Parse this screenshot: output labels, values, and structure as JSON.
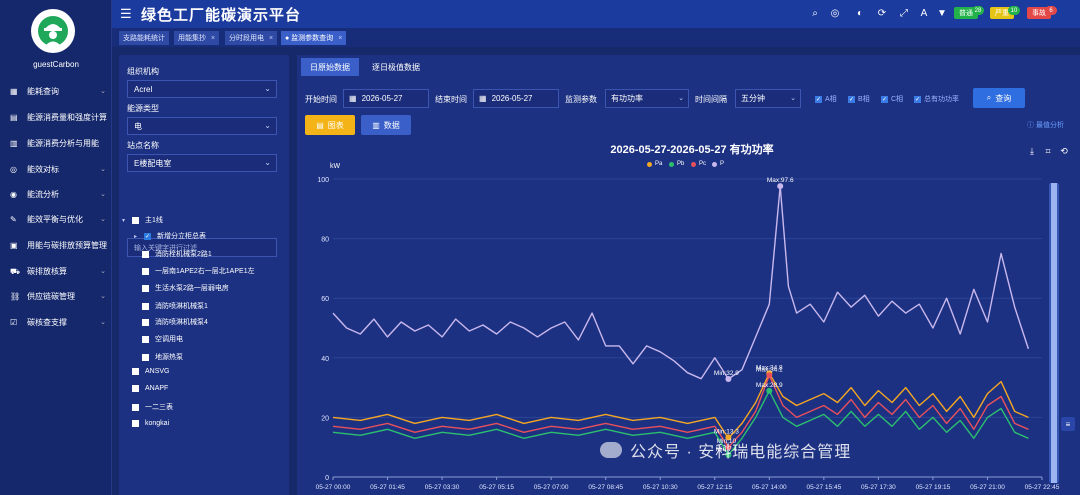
{
  "sidebar": {
    "user": "guestCarbon",
    "items": [
      {
        "label": "能耗查询",
        "icon": "dashboard-icon"
      },
      {
        "label": "能源消费量和强度计算",
        "icon": "ledger-icon"
      },
      {
        "label": "能源消费分析与用能",
        "icon": "analysis-icon"
      },
      {
        "label": "能效对标",
        "icon": "target-icon"
      },
      {
        "label": "能流分析",
        "icon": "globe-icon"
      },
      {
        "label": "能效平衡与优化",
        "icon": "edit-icon"
      },
      {
        "label": "用能与碳排放预算管理",
        "icon": "building-icon"
      },
      {
        "label": "碳排放核算",
        "icon": "truck-icon"
      },
      {
        "label": "供应链碳管理",
        "icon": "link-icon"
      },
      {
        "label": "碳核查支撑",
        "icon": "check-icon"
      }
    ]
  },
  "header": {
    "title": "绿色工厂能碳演示平台",
    "badges": [
      {
        "label": "普通",
        "count": "28",
        "color": "#23b24a"
      },
      {
        "label": "严重",
        "count": "10",
        "color": "#e6c415"
      },
      {
        "label": "事故",
        "count": "6",
        "color": "#e34848"
      }
    ]
  },
  "tabs": [
    {
      "label": "支路能耗统计",
      "close": ""
    },
    {
      "label": "用能集抄",
      "close": "×"
    },
    {
      "label": "分时段用电",
      "close": "×"
    },
    {
      "label": "● 监测参数查询",
      "close": "×"
    }
  ],
  "filter": {
    "org_label": "组织机构",
    "org_value": "Acrel",
    "energy_label": "能源类型",
    "energy_value": "电",
    "site_label": "站点名称",
    "site_value": "E楼配电室",
    "search_placeholder": "输入关键字进行过滤",
    "tree": [
      {
        "label": "主1线",
        "checked": false,
        "arrow": "▾"
      },
      {
        "label": "新增分立柜总表",
        "checked": true,
        "arrow": "▸"
      },
      {
        "label": "消防栓机械泵2路1",
        "checked": false,
        "arrow": ""
      },
      {
        "label": "一层南1APE2右一层北1APE1左",
        "checked": false,
        "arrow": ""
      },
      {
        "label": "生活水泵2路一层弱电房",
        "checked": false,
        "arrow": ""
      },
      {
        "label": "消防喷淋机械泵1",
        "checked": false,
        "arrow": ""
      },
      {
        "label": "消防喷淋机械泵4",
        "checked": false,
        "arrow": ""
      },
      {
        "label": "空调用电",
        "checked": false,
        "arrow": ""
      },
      {
        "label": "地源热泵",
        "checked": false,
        "arrow": ""
      },
      {
        "label": "ANSVG",
        "checked": false,
        "arrow": ""
      },
      {
        "label": "ANAPF",
        "checked": false,
        "arrow": ""
      },
      {
        "label": "一二三表",
        "checked": false,
        "arrow": ""
      },
      {
        "label": "kongkai",
        "checked": false,
        "arrow": ""
      }
    ]
  },
  "main": {
    "tabs": [
      "日原始数据",
      "逐日极值数据"
    ],
    "start_label": "开始时间",
    "start_value": "2026-05-27",
    "end_label": "结束时间",
    "end_value": "2026-05-27",
    "param_label": "监测参数",
    "param_value": "有功功率",
    "interval_label": "时间间隔",
    "interval_value": "五分钟",
    "checks": [
      "A相",
      "B相",
      "C相",
      "总有功功率"
    ],
    "query_label": "查询",
    "chart_btn": "图表",
    "data_btn": "数据",
    "extreme_label": "最值分析",
    "watermark": "公众号 · 安科瑞电能综合管理"
  },
  "chart_data": {
    "type": "line",
    "title": "2026-05-27-2026-05-27  有功功率",
    "unit": "kW",
    "ylim": [
      0,
      100
    ],
    "y_ticks": [
      "0",
      "20",
      "40",
      "60",
      "80",
      "100"
    ],
    "x_ticks": [
      "05-27 00:00",
      "05-27 01:45",
      "05-27 03:30",
      "05-27 05:15",
      "05-27 07:00",
      "05-27 08:45",
      "05-27 10:30",
      "05-27 12:15",
      "05-27 14:00",
      "05-27 15:45",
      "05-27 17:30",
      "05-27 19:15",
      "05-27 21:00",
      "05-27 22:45"
    ],
    "legend": [
      "Pa",
      "Pb",
      "Pc",
      "P"
    ],
    "colors": {
      "Pa": "#f5a623",
      "Pb": "#2bbf6f",
      "Pc": "#e8505b",
      "P": "#c8b8ee"
    },
    "series": [
      {
        "name": "P",
        "points": [
          [
            0,
            55
          ],
          [
            0.25,
            50
          ],
          [
            0.5,
            48
          ],
          [
            0.75,
            53
          ],
          [
            1.0,
            47
          ],
          [
            1.25,
            52
          ],
          [
            1.5,
            49
          ],
          [
            1.75,
            51
          ],
          [
            2.0,
            47
          ],
          [
            2.25,
            53
          ],
          [
            2.5,
            49
          ],
          [
            2.75,
            51
          ],
          [
            3.0,
            48
          ],
          [
            3.25,
            52
          ],
          [
            3.5,
            50
          ],
          [
            3.75,
            47
          ],
          [
            4.0,
            50
          ],
          [
            4.25,
            52
          ],
          [
            4.5,
            46
          ],
          [
            4.75,
            55
          ],
          [
            5.0,
            44
          ],
          [
            5.25,
            44
          ],
          [
            5.5,
            38
          ],
          [
            5.75,
            44
          ],
          [
            6.0,
            42
          ],
          [
            6.25,
            39
          ],
          [
            6.5,
            35
          ],
          [
            6.75,
            33
          ],
          [
            7.0,
            40
          ],
          [
            7.25,
            32.9
          ],
          [
            7.5,
            36
          ],
          [
            7.75,
            47
          ],
          [
            8.0,
            58
          ],
          [
            8.2,
            97.6
          ],
          [
            8.35,
            64
          ],
          [
            8.5,
            55
          ],
          [
            8.75,
            58
          ],
          [
            9.0,
            52
          ],
          [
            9.25,
            62
          ],
          [
            9.5,
            57
          ],
          [
            9.75,
            61
          ],
          [
            10.0,
            54
          ],
          [
            10.25,
            59
          ],
          [
            10.5,
            55
          ],
          [
            10.75,
            58
          ],
          [
            11.0,
            50
          ],
          [
            11.25,
            60
          ],
          [
            11.5,
            48
          ],
          [
            11.75,
            63
          ],
          [
            12.0,
            52
          ],
          [
            12.25,
            75
          ],
          [
            12.5,
            57
          ],
          [
            12.75,
            43
          ]
        ]
      },
      {
        "name": "Pa",
        "points": [
          [
            0,
            20
          ],
          [
            0.5,
            19
          ],
          [
            1.0,
            21
          ],
          [
            1.5,
            18
          ],
          [
            2.0,
            20
          ],
          [
            2.5,
            19
          ],
          [
            3.0,
            21
          ],
          [
            3.5,
            18
          ],
          [
            4.0,
            20
          ],
          [
            4.5,
            19
          ],
          [
            5.0,
            21
          ],
          [
            5.5,
            19
          ],
          [
            6.0,
            20
          ],
          [
            6.5,
            18
          ],
          [
            7.0,
            20
          ],
          [
            7.25,
            13
          ],
          [
            7.5,
            18
          ],
          [
            7.75,
            25
          ],
          [
            8.0,
            34.8
          ],
          [
            8.25,
            27
          ],
          [
            8.5,
            24
          ],
          [
            8.75,
            26
          ],
          [
            9.0,
            28
          ],
          [
            9.25,
            25
          ],
          [
            9.5,
            30
          ],
          [
            9.75,
            24
          ],
          [
            10.0,
            29
          ],
          [
            10.25,
            25
          ],
          [
            10.5,
            30
          ],
          [
            10.75,
            24
          ],
          [
            11.0,
            28
          ],
          [
            11.25,
            22
          ],
          [
            11.5,
            27
          ],
          [
            11.75,
            20
          ],
          [
            12.0,
            28
          ],
          [
            12.25,
            32
          ],
          [
            12.5,
            22
          ],
          [
            12.75,
            20
          ]
        ]
      },
      {
        "name": "Pc",
        "points": [
          [
            0,
            17
          ],
          [
            0.5,
            16
          ],
          [
            1.0,
            18
          ],
          [
            1.5,
            15
          ],
          [
            2.0,
            17
          ],
          [
            2.5,
            16
          ],
          [
            3.0,
            18
          ],
          [
            3.5,
            15
          ],
          [
            4.0,
            17
          ],
          [
            4.5,
            16
          ],
          [
            5.0,
            18
          ],
          [
            5.5,
            16
          ],
          [
            6.0,
            17
          ],
          [
            6.5,
            15
          ],
          [
            7.0,
            17
          ],
          [
            7.25,
            10
          ],
          [
            7.5,
            15
          ],
          [
            7.75,
            22
          ],
          [
            8.0,
            34.1
          ],
          [
            8.25,
            24
          ],
          [
            8.5,
            20
          ],
          [
            8.75,
            22
          ],
          [
            9.0,
            24
          ],
          [
            9.25,
            21
          ],
          [
            9.5,
            26
          ],
          [
            9.75,
            20
          ],
          [
            10.0,
            25
          ],
          [
            10.25,
            21
          ],
          [
            10.5,
            26
          ],
          [
            10.75,
            20
          ],
          [
            11.0,
            24
          ],
          [
            11.25,
            18
          ],
          [
            11.5,
            23
          ],
          [
            11.75,
            16
          ],
          [
            12.0,
            24
          ],
          [
            12.25,
            27
          ],
          [
            12.5,
            18
          ],
          [
            12.75,
            16
          ]
        ]
      },
      {
        "name": "Pb",
        "points": [
          [
            0,
            15
          ],
          [
            0.5,
            14
          ],
          [
            1.0,
            16
          ],
          [
            1.5,
            13
          ],
          [
            2.0,
            15
          ],
          [
            2.5,
            14
          ],
          [
            3.0,
            16
          ],
          [
            3.5,
            13
          ],
          [
            4.0,
            15
          ],
          [
            4.5,
            14
          ],
          [
            5.0,
            16
          ],
          [
            5.5,
            14
          ],
          [
            6.0,
            15
          ],
          [
            6.5,
            13
          ],
          [
            7.0,
            15
          ],
          [
            7.25,
            7.4
          ],
          [
            7.5,
            13
          ],
          [
            7.75,
            20
          ],
          [
            8.0,
            28.9
          ],
          [
            8.25,
            20
          ],
          [
            8.5,
            17
          ],
          [
            8.75,
            19
          ],
          [
            9.0,
            21
          ],
          [
            9.25,
            17
          ],
          [
            9.5,
            22
          ],
          [
            9.75,
            17
          ],
          [
            10.0,
            21
          ],
          [
            10.25,
            17
          ],
          [
            10.5,
            22
          ],
          [
            10.75,
            16
          ],
          [
            11.0,
            20
          ],
          [
            11.25,
            15
          ],
          [
            11.5,
            19
          ],
          [
            11.75,
            13
          ],
          [
            12.0,
            20
          ],
          [
            12.25,
            23
          ],
          [
            12.5,
            15
          ],
          [
            12.75,
            13
          ]
        ]
      }
    ],
    "markers": [
      {
        "series": "P",
        "label": "Max:97.6",
        "x": 8.2,
        "y": 97.6
      },
      {
        "series": "P",
        "label": "Min:32.9",
        "x": 7.25,
        "y": 32.9
      },
      {
        "series": "Pa",
        "label": "Max:34.8",
        "x": 8.0,
        "y": 34.8
      },
      {
        "series": "Pc",
        "label": "Max:34.1",
        "x": 8.0,
        "y": 34.1
      },
      {
        "series": "Pb",
        "label": "Max:28.9",
        "x": 8.0,
        "y": 28.9
      },
      {
        "series": "Pa",
        "label": "Min:13.3",
        "x": 7.25,
        "y": 13.3
      },
      {
        "series": "Pc",
        "label": "Min:10",
        "x": 7.25,
        "y": 10
      },
      {
        "series": "Pb",
        "label": "Min:7.4",
        "x": 7.25,
        "y": 7.4
      }
    ]
  }
}
